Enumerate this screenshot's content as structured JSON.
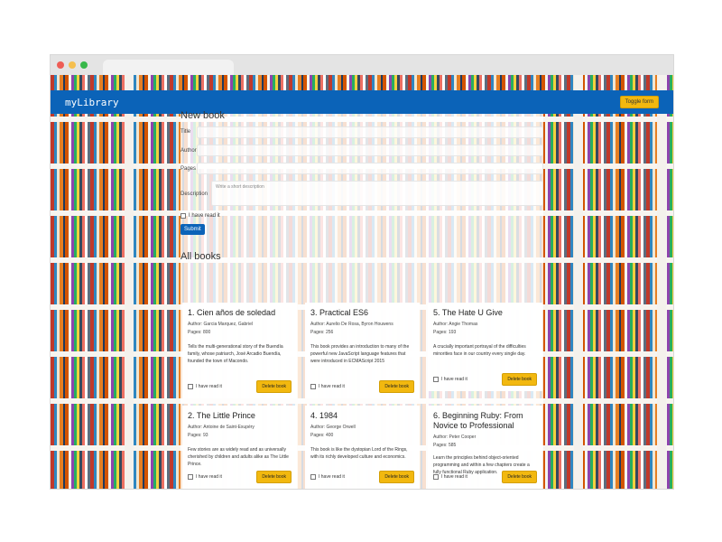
{
  "header": {
    "title": "myLibrary",
    "toggle_label": "Toggle form"
  },
  "form": {
    "title": "New book",
    "labels": {
      "title": "Title",
      "author": "Author",
      "pages": "Pages",
      "description": "Description"
    },
    "description_placeholder": "Write a short description",
    "read_label": "I have read it",
    "submit_label": "Submit"
  },
  "books_section": {
    "title": "All books"
  },
  "books": [
    {
      "title": "1. Cien años de soledad",
      "author": "Author: Garcia Marquez, Gabriel",
      "pages": "Pages: 800",
      "description": "Tells the multi-generational story of the Buendía family, whose patriarch, José Arcadio Buendía, founded the town of Macondo.",
      "read_label": "I have read it",
      "delete_label": "Delete book"
    },
    {
      "title": "3. Practical ES6",
      "author": "Author: Aurelio De Rosa, Byron Houwens",
      "pages": "Pages: 256",
      "description": "This book provides an introduction to many of the powerful new JavaScript language features that were introduced in ECMAScript 2015",
      "read_label": "I have read it",
      "delete_label": "Delete book"
    },
    {
      "title": "5. The Hate U Give",
      "author": "Author: Angie Thomas",
      "pages": "Pages: 193",
      "description": "A crucially important portrayal of the difficulties minorities face in our country every single day.",
      "read_label": "I have read it",
      "delete_label": "Delete book"
    },
    {
      "title": "2. The Little Prince",
      "author": "Author: Antoine de Saint-Exupéry",
      "pages": "Pages: 93",
      "description": "Few stories are as widely read and as universally cherished by children and adults alike as The Little Prince.",
      "read_label": "I have read it",
      "delete_label": "Delete book"
    },
    {
      "title": "4. 1984",
      "author": "Author: George Orwell",
      "pages": "Pages: 400",
      "description": "This book is like the dystopian Lord of the Rings, with its richly developed culture and economics.",
      "read_label": "I have read it",
      "delete_label": "Delete book"
    },
    {
      "title": "6. Beginning Ruby: From Novice to Professional",
      "author": "Author: Peter Cooper",
      "pages": "Pages: 585",
      "description": "Learn the principles behind object-oriented programming and within a few chapters create a fully functional Ruby application.",
      "read_label": "I have read it",
      "delete_label": "Delete book"
    }
  ],
  "colors": {
    "header": "#0b63b8",
    "accent": "#f2b80f"
  }
}
